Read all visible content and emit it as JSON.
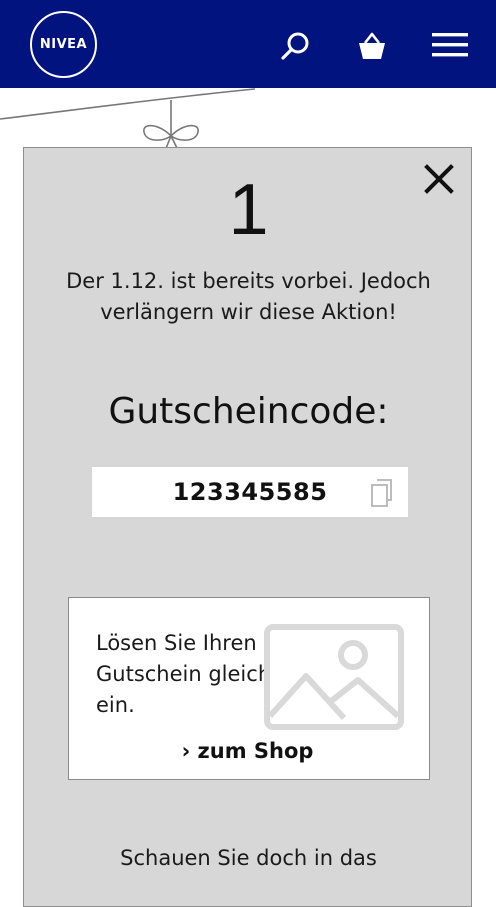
{
  "header": {
    "logo_text": "NIVEA",
    "background": "#00137f",
    "icons": [
      "search-icon",
      "basket-icon",
      "menu-icon"
    ]
  },
  "popup": {
    "day_number": "1",
    "info_text": "Der 1.12. ist bereits vorbei. Jedoch verlängern wir diese Aktion!",
    "code_heading": "Gutscheincode:",
    "code_value": "123345585",
    "shop_text": "Lösen Sie Ihren Gutschein gleich ein.",
    "shop_link": "› zum Shop",
    "bottom_text": "Schauen Sie doch in das",
    "background": "#d7d7d7"
  }
}
